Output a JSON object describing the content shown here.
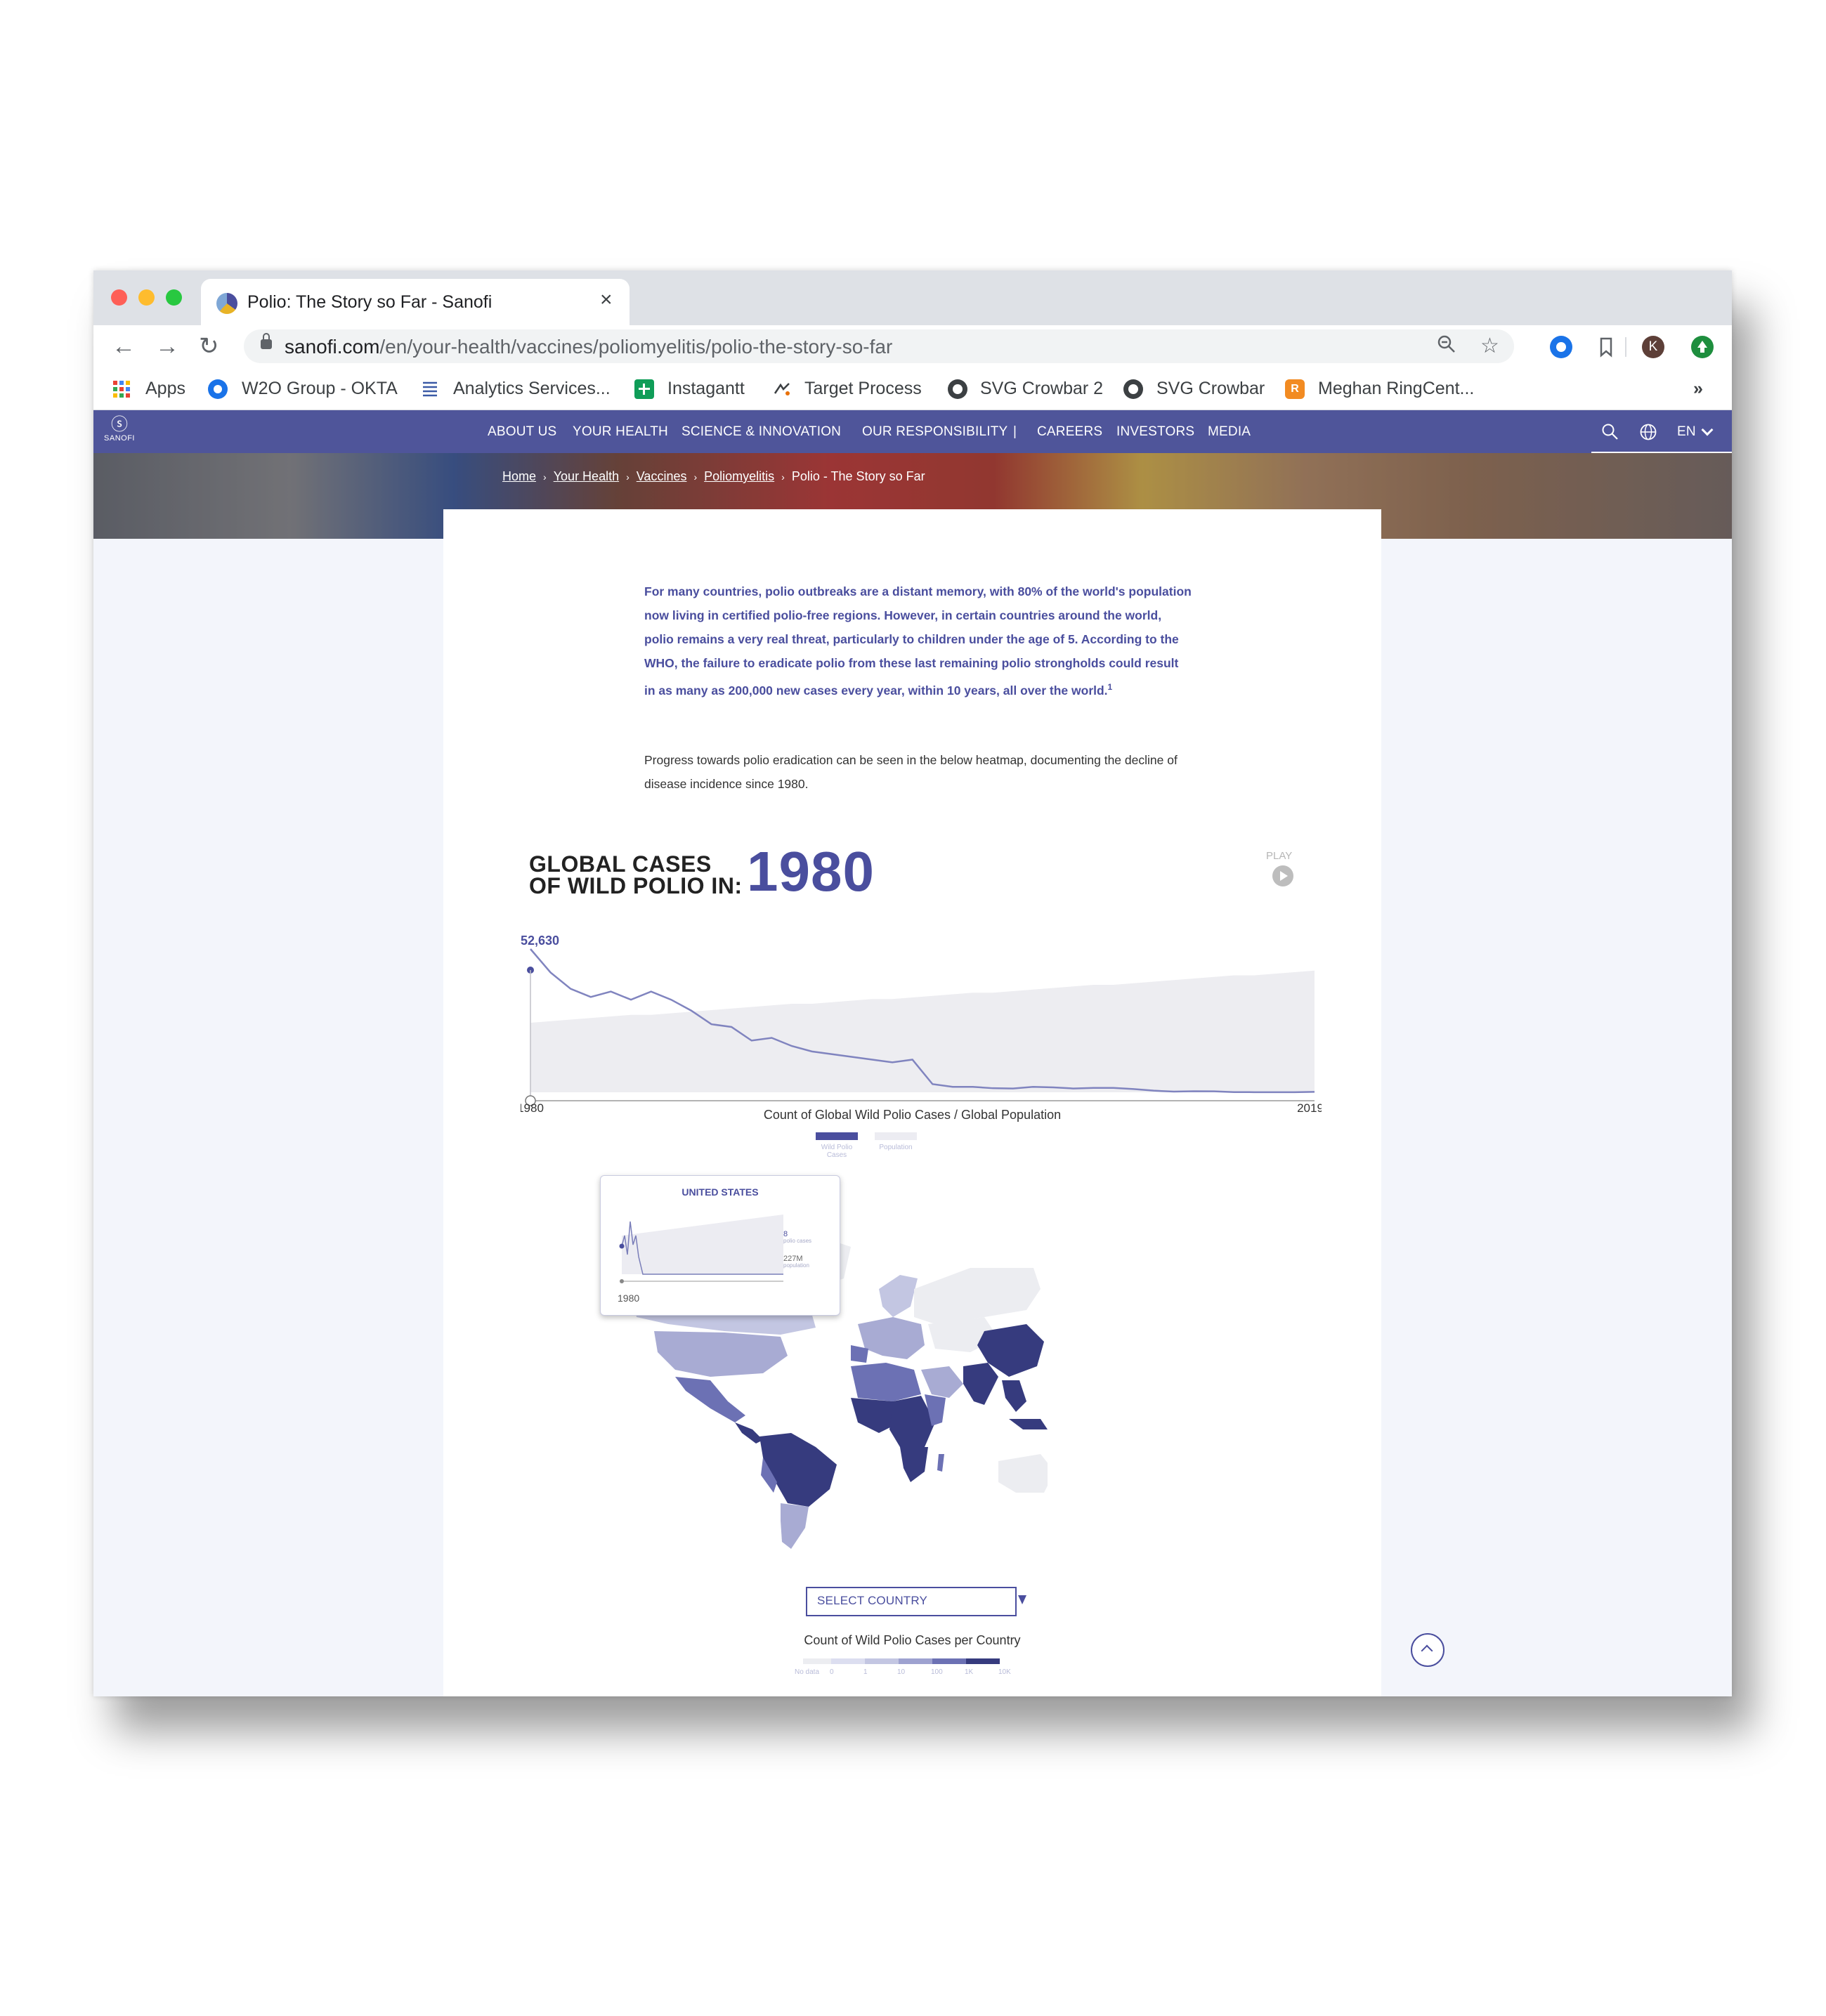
{
  "browser": {
    "tab_title": "Polio: The Story so Far - Sanofi",
    "url_domain": "sanofi.com",
    "url_path": "/en/your-health/vaccines/poliomyelitis/polio-the-story-so-far",
    "profile_initial": "K",
    "bookmarks": [
      "Apps",
      "W2O Group - OKTA",
      "Analytics Services...",
      "Instagantt",
      "Target Process",
      "SVG Crowbar 2",
      "SVG Crowbar",
      "Meghan RingCent..."
    ],
    "overflow": "»"
  },
  "site": {
    "logo_text": "SANOFI",
    "nav": [
      "ABOUT US",
      "YOUR HEALTH",
      "SCIENCE & INNOVATION",
      "OUR RESPONSIBILITY",
      "|",
      "CAREERS",
      "INVESTORS",
      "MEDIA"
    ],
    "lang": "EN",
    "breadcrumbs": [
      "Home",
      "Your Health",
      "Vaccines",
      "Poliomyelitis"
    ],
    "breadcrumb_current": "Polio - The Story so Far"
  },
  "article": {
    "intro": "For many countries, polio outbreaks are a distant memory, with 80% of the world's population now living in certified polio-free regions. However, in certain countries around the world, polio remains a very real threat, particularly to children under the age of 5. According to the WHO, the failure to eradicate polio from these last remaining polio strongholds could result in as many as 200,000 new cases every year, within 10 years, all over the world.",
    "intro_footnote": "1",
    "body": "Progress towards polio eradication can be seen in the below heatmap, documenting the decline of disease incidence since 1980."
  },
  "viz": {
    "title_line1": "GLOBAL CASES",
    "title_line2": "OF WILD POLIO IN:",
    "year": "1980",
    "play_label": "PLAY",
    "peak_label": "52,630",
    "x_start": "1980",
    "x_end": "2019",
    "caption": "Count of Global Wild Polio Cases / Global Population",
    "legend": [
      "Wild Polio Cases",
      "Population"
    ],
    "tooltip": {
      "country": "UNITED STATES",
      "year": "1980",
      "cases_value": "8",
      "cases_label": "polio cases",
      "pop_value": "227M",
      "pop_label": "population"
    },
    "select_placeholder": "SELECT COUNTRY",
    "map_caption": "Count of Wild Polio Cases per Country",
    "scale_labels": [
      "No data",
      "0",
      "1",
      "10",
      "100",
      "1K",
      "10K"
    ]
  },
  "colors": {
    "brand": "#4f559a",
    "accent": "#4a4e9e",
    "map_high": "#363b7e",
    "map_mid": "#6c71b4",
    "map_low": "#c3c6e2",
    "map_none": "#ecedf1"
  },
  "chart_data": {
    "type": "line",
    "x": [
      1980,
      1981,
      1982,
      1983,
      1984,
      1985,
      1986,
      1987,
      1988,
      1989,
      1990,
      1991,
      1992,
      1993,
      1994,
      1995,
      1996,
      1997,
      1998,
      1999,
      2000,
      2001,
      2002,
      2003,
      2004,
      2005,
      2006,
      2007,
      2008,
      2009,
      2010,
      2011,
      2012,
      2013,
      2014,
      2015,
      2016,
      2017,
      2018,
      2019
    ],
    "series": [
      {
        "name": "Wild Polio Cases",
        "values": [
          52630,
          44000,
          38000,
          35000,
          37000,
          34000,
          37000,
          34000,
          30000,
          25000,
          24000,
          19000,
          20000,
          17000,
          15000,
          14000,
          13000,
          12000,
          11000,
          12000,
          3000,
          2000,
          2000,
          1500,
          1400,
          2000,
          1800,
          1400,
          1600,
          1600,
          1200,
          600,
          250,
          400,
          350,
          80,
          40,
          22,
          33,
          176
        ]
      },
      {
        "name": "Population",
        "values": [
          4.4,
          4.5,
          4.6,
          4.7,
          4.8,
          4.9,
          4.9,
          5.0,
          5.1,
          5.2,
          5.3,
          5.4,
          5.5,
          5.6,
          5.6,
          5.7,
          5.8,
          5.9,
          5.9,
          6.0,
          6.1,
          6.2,
          6.3,
          6.3,
          6.4,
          6.5,
          6.6,
          6.7,
          6.8,
          6.8,
          6.9,
          7.0,
          7.1,
          7.2,
          7.3,
          7.4,
          7.4,
          7.5,
          7.6,
          7.7
        ]
      }
    ],
    "xlabel": "",
    "ylabel": ""
  }
}
